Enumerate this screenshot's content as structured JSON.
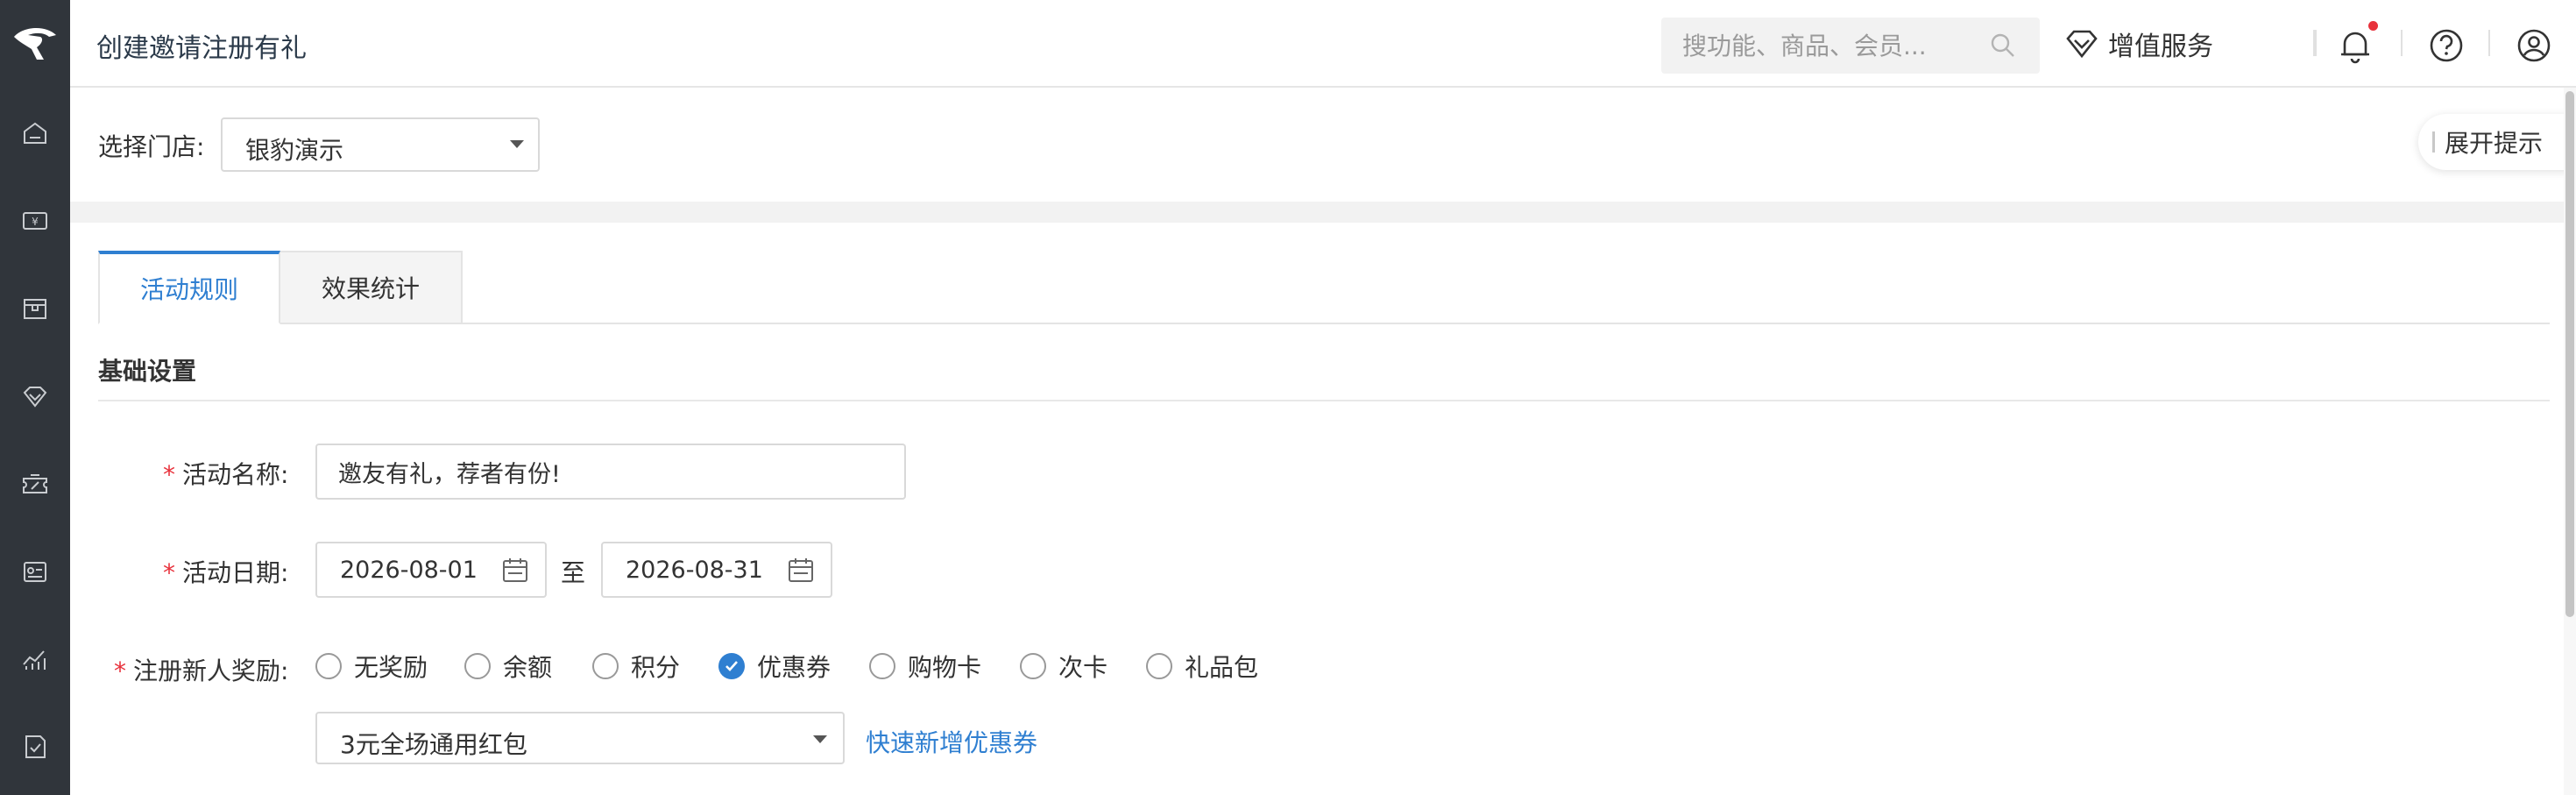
{
  "colors": {
    "rail_bg": "#30353b",
    "accent": "#2f7fd1",
    "required": "#e8323c",
    "notice_dot": "#e8323c"
  },
  "rail": {
    "logo_icon": "leopard-logo",
    "items": [
      {
        "icon": "home-icon"
      },
      {
        "icon": "cashier-icon"
      },
      {
        "icon": "goods-box-icon"
      },
      {
        "icon": "diamond-icon"
      },
      {
        "icon": "marketing-coupon-icon"
      },
      {
        "icon": "member-card-icon"
      },
      {
        "icon": "analytics-chart-icon"
      },
      {
        "icon": "report-doc-icon"
      }
    ]
  },
  "header": {
    "title": "创建邀请注册有礼",
    "search_placeholder": "搜功能、商品、会员...",
    "vip_label": "增值服务"
  },
  "store": {
    "label": "选择门店:",
    "selected": "银豹演示",
    "tip_label": "展开提示"
  },
  "tabs": [
    {
      "label": "活动规则",
      "active": true
    },
    {
      "label": "效果统计",
      "active": false
    }
  ],
  "section": {
    "title": "基础设置"
  },
  "form": {
    "required_mark": "*",
    "name_label": "活动名称:",
    "name_value": "邀友有礼，荐者有份!",
    "date_label": "活动日期:",
    "start_date": "2026-08-01",
    "to_label": "至",
    "end_date": "2026-08-31",
    "reward_label": "注册新人奖励:",
    "reward_options": [
      "无奖励",
      "余额",
      "积分",
      "优惠券",
      "购物卡",
      "次卡",
      "礼品包"
    ],
    "reward_selected": "优惠券",
    "coupon_selected": "3元全场通用红包",
    "add_coupon_link": "快速新增优惠券"
  }
}
